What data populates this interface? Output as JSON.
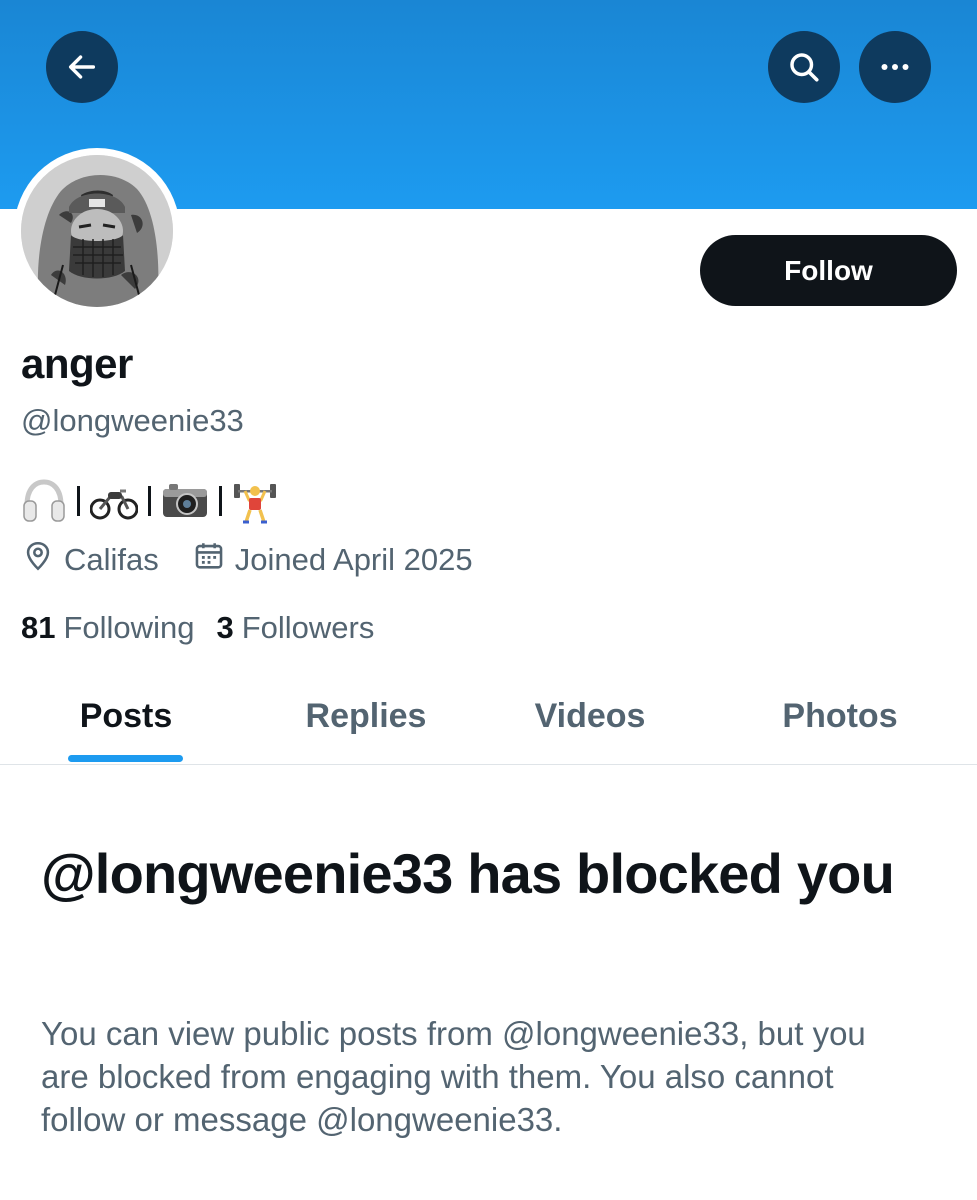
{
  "header": {
    "back_icon": "arrow-left-icon",
    "search_icon": "search-icon",
    "more_icon": "more-horizontal-icon",
    "banner_color": "#1d9bf0"
  },
  "profile": {
    "display_name": "anger",
    "handle": "@longweenie33",
    "follow_label": "Follow",
    "bio_icons": [
      "headphones-icon",
      "motorcycle-icon",
      "camera-icon",
      "weightlifter-icon"
    ],
    "location": "Califas",
    "location_icon": "location-pin-icon",
    "joined": "Joined April 2025",
    "joined_icon": "calendar-icon",
    "following_count": "81",
    "following_label": "Following",
    "followers_count": "3",
    "followers_label": "Followers"
  },
  "tabs": [
    {
      "label": "Posts",
      "active": true
    },
    {
      "label": "Replies",
      "active": false
    },
    {
      "label": "Videos",
      "active": false
    },
    {
      "label": "Photos",
      "active": false
    }
  ],
  "blocked": {
    "title": "@longweenie33 has blocked you",
    "description": "You can view public posts from @longweenie33, but you are blocked from engaging with them. You also cannot follow or message @longweenie33."
  },
  "colors": {
    "accent": "#1d9bf0",
    "text_primary": "#0f1419",
    "text_secondary": "#536471"
  }
}
